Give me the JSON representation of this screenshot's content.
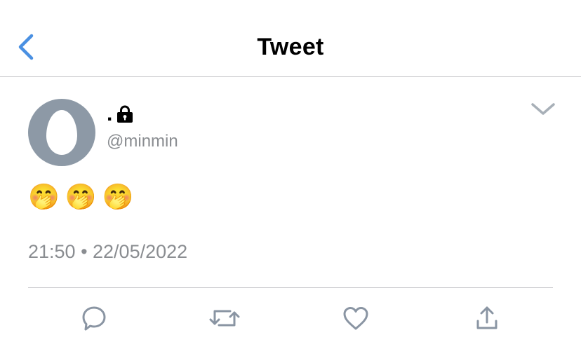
{
  "header": {
    "title": "Tweet",
    "back_icon": "chevron-left-icon"
  },
  "tweet": {
    "author": {
      "display_name": ".",
      "handle": "@minmin",
      "protected": true,
      "lock_icon": "lock-icon",
      "avatar": "default-egg-avatar"
    },
    "text": "🤭🤭🤭",
    "time": "21:50",
    "separator": "•",
    "date": "22/05/2022",
    "timestamp": "21:50 • 22/05/2022",
    "menu_icon": "chevron-down-icon"
  },
  "actions": [
    {
      "name": "reply",
      "icon": "reply-icon"
    },
    {
      "name": "retweet",
      "icon": "retweet-icon"
    },
    {
      "name": "like",
      "icon": "heart-icon"
    },
    {
      "name": "share",
      "icon": "share-icon"
    }
  ],
  "colors": {
    "accent": "#4a90e2",
    "muted_text": "#8a8d91",
    "divider": "#c8c8cc",
    "avatar_bg": "#8d99a6",
    "icon_gray": "#8a95a3"
  }
}
